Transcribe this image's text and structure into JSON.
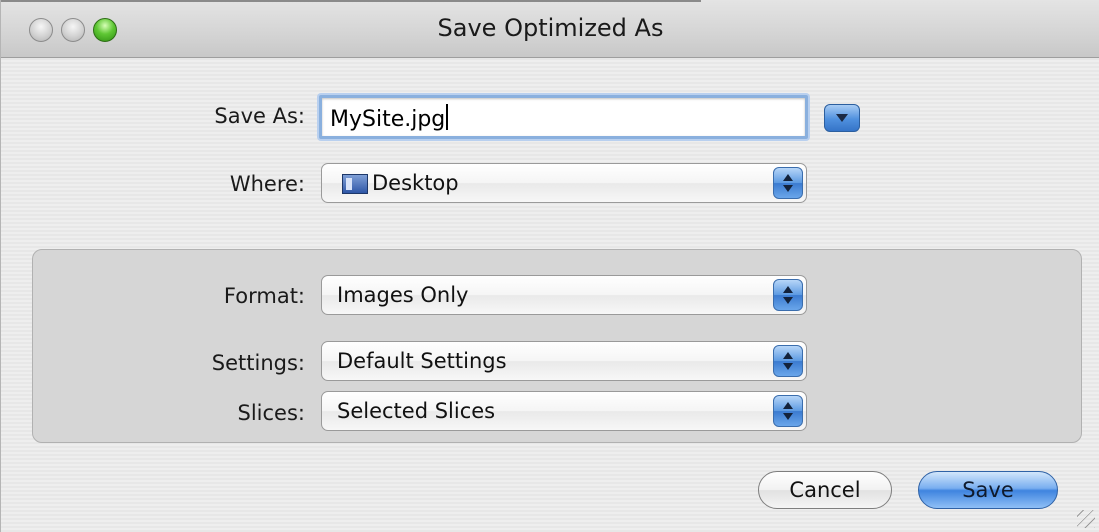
{
  "window": {
    "title": "Save Optimized As"
  },
  "save_as": {
    "label": "Save As:",
    "value": "MySite.jpg"
  },
  "where": {
    "label": "Where:",
    "value": "Desktop",
    "icon": "desktop-folder-icon"
  },
  "format": {
    "label": "Format:",
    "value": "Images Only"
  },
  "settings": {
    "label": "Settings:",
    "value": "Default Settings"
  },
  "slices": {
    "label": "Slices:",
    "value": "Selected Slices"
  },
  "buttons": {
    "cancel": "Cancel",
    "save": "Save"
  },
  "colors": {
    "accent": "#3f84df",
    "focus_ring": "#8ab0de"
  }
}
